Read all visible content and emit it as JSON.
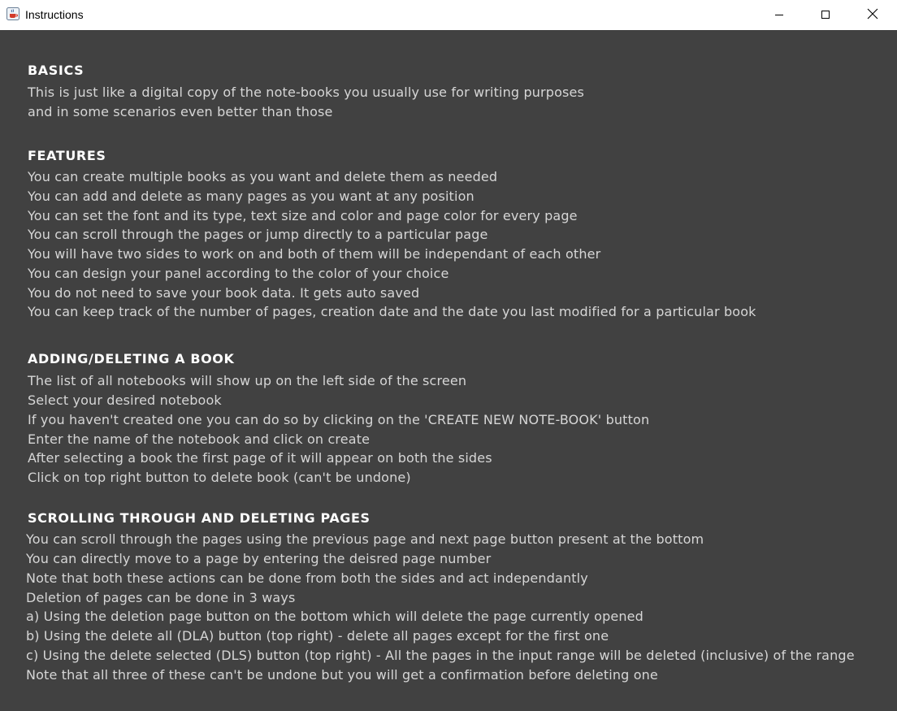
{
  "window": {
    "title": "Instructions",
    "app_icon": "java-cup-icon",
    "controls": [
      "minimize-icon",
      "maximize-icon",
      "close-icon"
    ]
  },
  "colors": {
    "content_background": "#414141",
    "heading_text": "#ffffff",
    "body_text": "#d6d6d6",
    "titlebar_background": "#ffffff"
  },
  "sections": {
    "basics": {
      "heading": "BASICS",
      "lines": [
        "This is just like a digital copy of the note-books you usually use for writing purposes",
        "and in some scenarios even better than those"
      ]
    },
    "features": {
      "heading": "FEATURES",
      "lines": [
        "You can create multiple books as you want and delete them as needed",
        "You can add and delete as many pages as you want at any position",
        "You can set the font and its type, text size and color and page color for every page",
        "You can scroll through the pages or jump directly to a particular page",
        "You will have two sides to work on and both of them will be independant of each other",
        "You can design your panel according to the color of your choice",
        "You do not need to save your book data. It gets auto saved",
        "You can keep track of the number of pages, creation date and the date you last modified for a particular book"
      ]
    },
    "adding": {
      "heading": "ADDING/DELETING A BOOK",
      "lines": [
        "The list of all notebooks will show up on the left side of the screen",
        "Select your desired notebook",
        "If you haven't created one you can do so by clicking on the 'CREATE NEW NOTE-BOOK' button",
        "Enter the name of the notebook and click on create",
        "After selecting a book the first page of it will appear on both the sides",
        "Click on top right button to delete book (can't be undone)"
      ]
    },
    "scrolling": {
      "heading": "SCROLLING THROUGH AND DELETING PAGES",
      "lines": [
        "You can scroll through the pages using the previous page and next page button present at the bottom",
        "You can directly move to a page by entering the deisred page number",
        "Note that both these actions can be done from both the sides and act independantly",
        "Deletion of pages can be done in 3 ways",
        "a) Using the deletion page button on the bottom which will delete the page currently opened",
        "b) Using the delete all (DLA) button (top right) - delete all pages except for the first one",
        "c) Using the delete selected (DLS) button (top right) - All the pages in the input range will be deleted (inclusive) of the range",
        "Note that all three of these can't be undone but you will get a confirmation before deleting one"
      ]
    }
  }
}
